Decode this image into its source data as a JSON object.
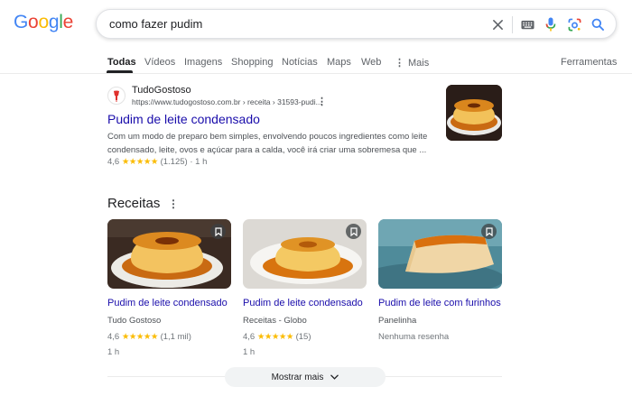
{
  "logo": {
    "letters": [
      {
        "ch": "G",
        "color": "#4285F4"
      },
      {
        "ch": "o",
        "color": "#EA4335"
      },
      {
        "ch": "o",
        "color": "#FBBC05"
      },
      {
        "ch": "g",
        "color": "#4285F4"
      },
      {
        "ch": "l",
        "color": "#34A853"
      },
      {
        "ch": "e",
        "color": "#EA4335"
      }
    ]
  },
  "search": {
    "query": "como fazer pudim",
    "icons": [
      "clear-icon",
      "keyboard-icon",
      "mic-icon",
      "lens-icon",
      "search-icon"
    ]
  },
  "tabs": {
    "all": "Todas",
    "videos": "Vídeos",
    "images": "Imagens",
    "shopping": "Shopping",
    "news": "Notícias",
    "maps": "Maps",
    "web": "Web",
    "more": "Mais",
    "tools": "Ferramentas"
  },
  "result": {
    "site_name": "TudoGostoso",
    "url": "https://www.tudogostoso.com.br › receita › 31593-pudi...",
    "title": "Pudim de leite condensado",
    "snippet": "Com um modo de preparo bem simples, envolvendo poucos ingredientes como leite condensado, leite, ovos e açúcar para a calda, você irá criar uma sobremesa que ...",
    "rating": "4,6",
    "stars": "★★★★★",
    "reviews": "(1.125)",
    "time": "1 h"
  },
  "recipes": {
    "title": "Receitas",
    "cards": [
      {
        "title": "Pudim de leite condensado",
        "source": "Tudo Gostoso",
        "rating": "4,6",
        "stars": "★★★★★",
        "reviews": "(1,1 mil)",
        "time": "1 h"
      },
      {
        "title": "Pudim de leite condensado",
        "source": "Receitas - Globo",
        "rating": "4,6",
        "stars": "★★★★★",
        "reviews": "(15)",
        "time": "1 h"
      },
      {
        "title": "Pudim de leite com furinhos",
        "source": "Panelinha",
        "no_reviews": "Nenhuma resenha"
      }
    ]
  },
  "more_button": "Mostrar mais",
  "colors": {
    "link": "#1a0dab",
    "star": "#fbbc04",
    "caramel": "#c96a12",
    "custard": "#f2c25a"
  }
}
